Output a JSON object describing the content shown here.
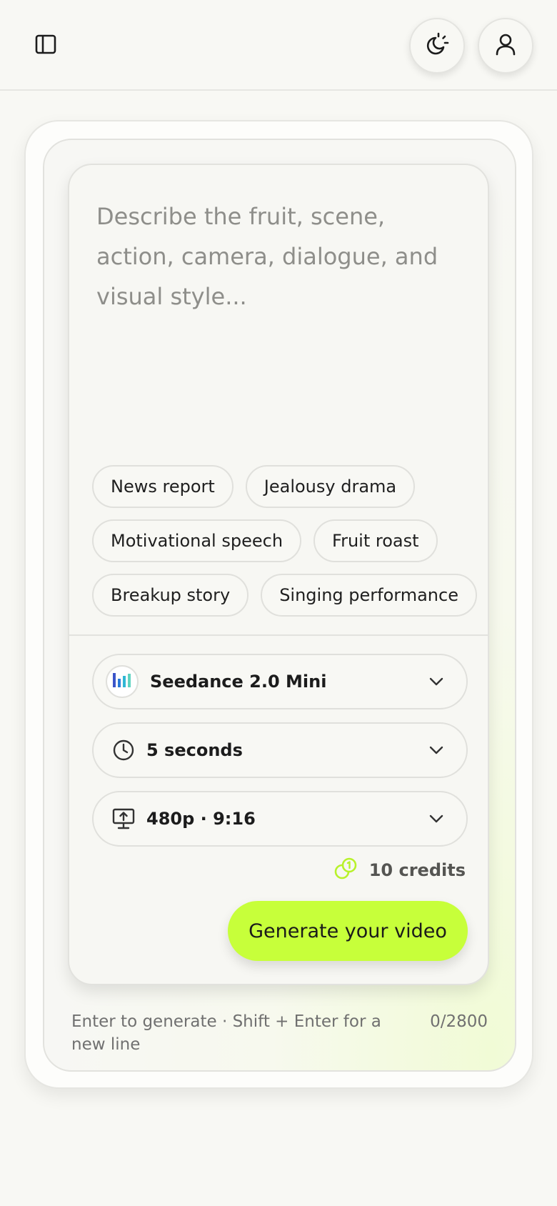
{
  "header": {
    "sidebar_icon": "sidebar-panel-icon",
    "theme_icon": "sun-moon-icon",
    "user_icon": "user-icon"
  },
  "composer": {
    "prompt_placeholder": "Describe the fruit, scene, action, camera, dialogue, and visual style...",
    "prompt_value": "",
    "chips": [
      "News report",
      "Jealousy drama",
      "Motivational speech",
      "Fruit roast",
      "Breakup story",
      "Singing performance"
    ],
    "model": {
      "label": "Seedance 2.0 Mini",
      "icon": "bar-chart-logo-icon"
    },
    "duration": {
      "label": "5 seconds",
      "icon": "clock-icon"
    },
    "resolution": {
      "label": "480p · 9:16",
      "icon": "monitor-upload-icon"
    },
    "credits": {
      "label": "10 credits",
      "icon": "coins-icon",
      "color": "#b8f22a"
    },
    "generate_label": "Generate your video",
    "accent_color": "#c7ff3a"
  },
  "footer": {
    "hint": "Enter to generate · Shift + Enter for a new line",
    "counter": "0/2800"
  }
}
